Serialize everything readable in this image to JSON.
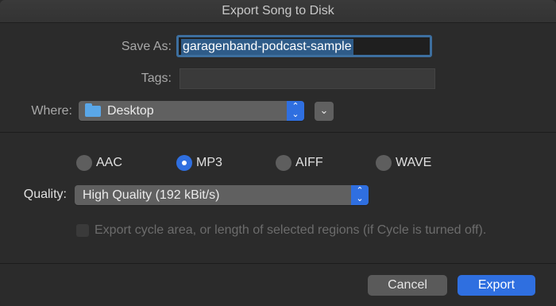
{
  "window": {
    "title": "Export Song to Disk"
  },
  "save_as": {
    "label": "Save As:",
    "value": "garagenband-podcast-sample"
  },
  "tags": {
    "label": "Tags:",
    "value": ""
  },
  "where": {
    "label": "Where:",
    "value": "Desktop",
    "icon": "folder-icon"
  },
  "format": {
    "options": [
      "AAC",
      "MP3",
      "AIFF",
      "WAVE"
    ],
    "selected": "MP3"
  },
  "quality": {
    "label": "Quality:",
    "value": "High Quality (192 kBit/s)"
  },
  "cycle_option": {
    "label": "Export cycle area, or length of selected regions (if Cycle is turned off).",
    "checked": false,
    "enabled": false
  },
  "buttons": {
    "cancel": "Cancel",
    "export": "Export"
  },
  "colors": {
    "accent": "#2f6fe0",
    "selection": "#2f5c89"
  }
}
